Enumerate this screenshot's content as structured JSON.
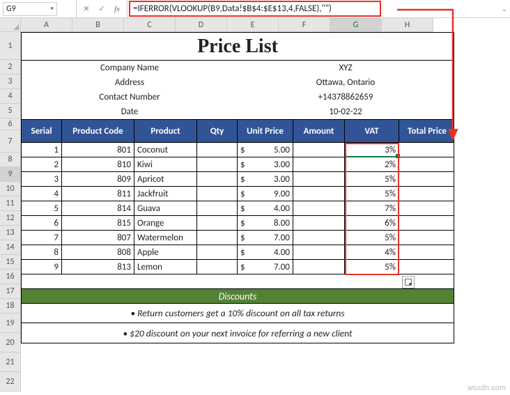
{
  "formula_bar": {
    "name_box": "G9",
    "formula": "=IFERROR(VLOOKUP(B9,Data!$B$4:$E$13,4,FALSE),\"\")"
  },
  "columns": [
    "A",
    "B",
    "C",
    "D",
    "E",
    "F",
    "G",
    "H"
  ],
  "row_numbers": [
    "1",
    "2",
    "3",
    "4",
    "5",
    "6",
    "7",
    "8",
    "9",
    "10",
    "11",
    "12",
    "13",
    "14",
    "15",
    "16",
    "17",
    "18",
    "19",
    "20",
    "21",
    "22"
  ],
  "active_col": "G",
  "active_row": "9",
  "title": "Price List",
  "company_info": {
    "labels": {
      "name": "Company Name",
      "address": "Address",
      "contact": "Contact Number",
      "date": "Date"
    },
    "values": {
      "name": "XYZ",
      "address": "Ottawa, Ontario",
      "contact": "+14378862659",
      "date": "10-02-22"
    }
  },
  "headers": {
    "serial": "Serial",
    "code": "Product Code",
    "product": "Product",
    "qty": "Qty",
    "unit": "Unit Price",
    "amount": "Amount",
    "vat": "VAT",
    "total": "Total Price"
  },
  "rows": [
    {
      "serial": "1",
      "code": "801",
      "product": "Coconut",
      "cur": "$",
      "price": "5.00",
      "vat": "3%"
    },
    {
      "serial": "2",
      "code": "810",
      "product": "Kiwi",
      "cur": "$",
      "price": "3.00",
      "vat": "2%"
    },
    {
      "serial": "3",
      "code": "809",
      "product": "Apricot",
      "cur": "$",
      "price": "3.00",
      "vat": "5%"
    },
    {
      "serial": "4",
      "code": "811",
      "product": "Jackfruit",
      "cur": "$",
      "price": "9.00",
      "vat": "5%"
    },
    {
      "serial": "5",
      "code": "814",
      "product": "Guava",
      "cur": "$",
      "price": "4.00",
      "vat": "7%"
    },
    {
      "serial": "6",
      "code": "815",
      "product": "Orange",
      "cur": "$",
      "price": "8.00",
      "vat": "6%"
    },
    {
      "serial": "7",
      "code": "807",
      "product": "Watermelon",
      "cur": "$",
      "price": "7.00",
      "vat": "5%"
    },
    {
      "serial": "8",
      "code": "808",
      "product": "Apple",
      "cur": "$",
      "price": "4.00",
      "vat": "4%"
    },
    {
      "serial": "9",
      "code": "813",
      "product": "Lemon",
      "cur": "$",
      "price": "7.00",
      "vat": "5%"
    }
  ],
  "discounts": {
    "heading": "Discounts",
    "line1": "• Return customers get a 10% discount on all tax returns",
    "line2": "• $20 discount on your next invoice for referring a new client"
  },
  "icons": {
    "cancel": "✕",
    "confirm": "✓",
    "expand": "⌄",
    "chev": "▾"
  },
  "watermark": "wsxdn.com",
  "chart_data": {
    "type": "table",
    "title": "Price List",
    "columns": [
      "Serial",
      "Product Code",
      "Product",
      "Qty",
      "Unit Price",
      "Amount",
      "VAT",
      "Total Price"
    ],
    "rows": [
      [
        1,
        801,
        "Coconut",
        null,
        5.0,
        null,
        "3%",
        null
      ],
      [
        2,
        810,
        "Kiwi",
        null,
        3.0,
        null,
        "2%",
        null
      ],
      [
        3,
        809,
        "Apricot",
        null,
        3.0,
        null,
        "5%",
        null
      ],
      [
        4,
        811,
        "Jackfruit",
        null,
        9.0,
        null,
        "5%",
        null
      ],
      [
        5,
        814,
        "Guava",
        null,
        4.0,
        null,
        "7%",
        null
      ],
      [
        6,
        815,
        "Orange",
        null,
        8.0,
        null,
        "6%",
        null
      ],
      [
        7,
        807,
        "Watermelon",
        null,
        7.0,
        null,
        "5%",
        null
      ],
      [
        8,
        808,
        "Apple",
        null,
        4.0,
        null,
        "4%",
        null
      ],
      [
        9,
        813,
        "Lemon",
        null,
        7.0,
        null,
        "5%",
        null
      ]
    ]
  }
}
